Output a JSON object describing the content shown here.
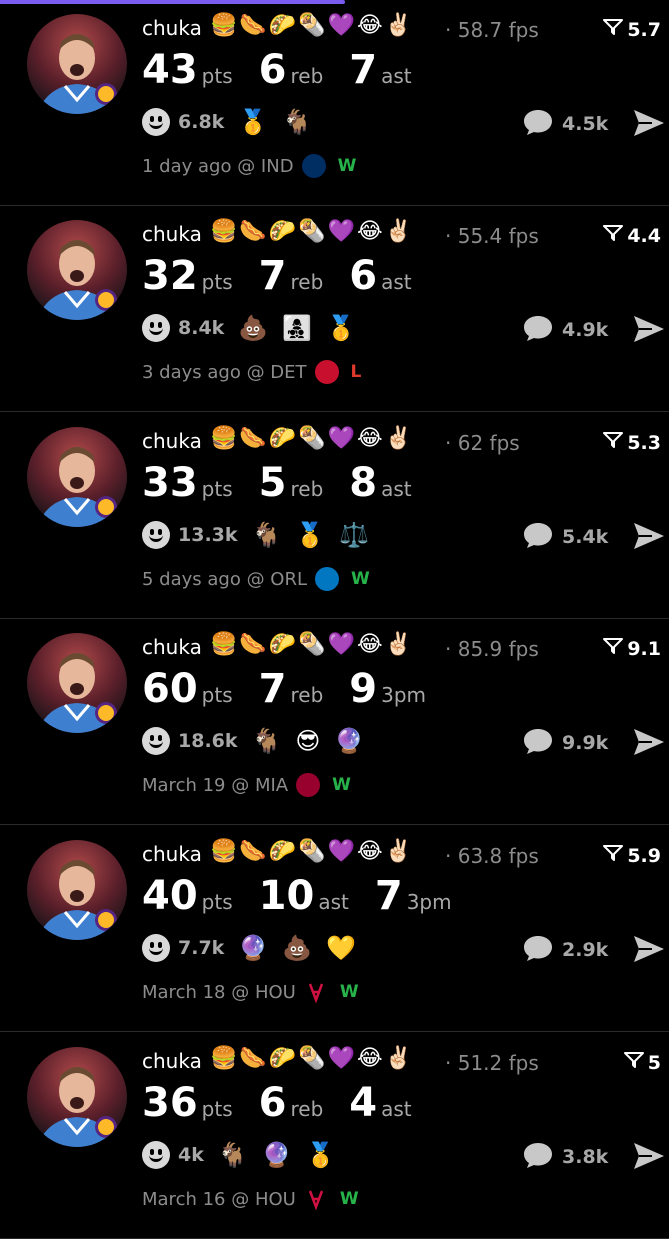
{
  "author": "chuka",
  "emojis": "🍔🌭🌮🌯💜😂✌🏻",
  "posts": [
    {
      "fps": "· 58.7 fps",
      "score": "5.7",
      "stats": [
        {
          "v": "43",
          "u": "pts"
        },
        {
          "v": "6",
          "u": "reb"
        },
        {
          "v": "7",
          "u": "ast"
        }
      ],
      "reactions": "6.8k",
      "badges": "🥇🐐",
      "comments": "4.5k",
      "time": "1 day ago @ IND",
      "result": "W"
    },
    {
      "fps": "· 55.4 fps",
      "score": "4.4",
      "stats": [
        {
          "v": "32",
          "u": "pts"
        },
        {
          "v": "7",
          "u": "reb"
        },
        {
          "v": "6",
          "u": "ast"
        }
      ],
      "reactions": "8.4k",
      "badges": "💩👩‍👧‍👦🥇",
      "comments": "4.9k",
      "time": "3 days ago @ DET",
      "result": "L"
    },
    {
      "fps": "· 62 fps",
      "score": "5.3",
      "stats": [
        {
          "v": "33",
          "u": "pts"
        },
        {
          "v": "5",
          "u": "reb"
        },
        {
          "v": "8",
          "u": "ast"
        }
      ],
      "reactions": "13.3k",
      "badges": "🐐🥇⚖️",
      "comments": "5.4k",
      "time": "5 days ago @ ORL",
      "result": "W"
    },
    {
      "fps": "· 85.9 fps",
      "score": "9.1",
      "stats": [
        {
          "v": "60",
          "u": "pts"
        },
        {
          "v": "7",
          "u": "reb"
        },
        {
          "v": "9",
          "u": "3pm"
        }
      ],
      "reactions": "18.6k",
      "badges": "🐐😎🔮",
      "comments": "9.9k",
      "time": "March 19 @ MIA",
      "result": "W"
    },
    {
      "fps": "· 63.8 fps",
      "score": "5.9",
      "stats": [
        {
          "v": "40",
          "u": "pts"
        },
        {
          "v": "10",
          "u": "ast"
        },
        {
          "v": "7",
          "u": "3pm"
        }
      ],
      "reactions": "7.7k",
      "badges": "🔮💩💛",
      "comments": "2.9k",
      "time": "March 18 @ HOU",
      "result": "W"
    },
    {
      "fps": "· 51.2 fps",
      "score": "5",
      "stats": [
        {
          "v": "36",
          "u": "pts"
        },
        {
          "v": "6",
          "u": "reb"
        },
        {
          "v": "4",
          "u": "ast"
        }
      ],
      "reactions": "4k",
      "badges": "🐐🔮🥇",
      "comments": "3.8k",
      "time": "March 16 @ HOU",
      "result": "W"
    }
  ],
  "colors": {
    "win": "#27b24a",
    "loss": "#e0392d",
    "accent": "#7b5cf0"
  }
}
